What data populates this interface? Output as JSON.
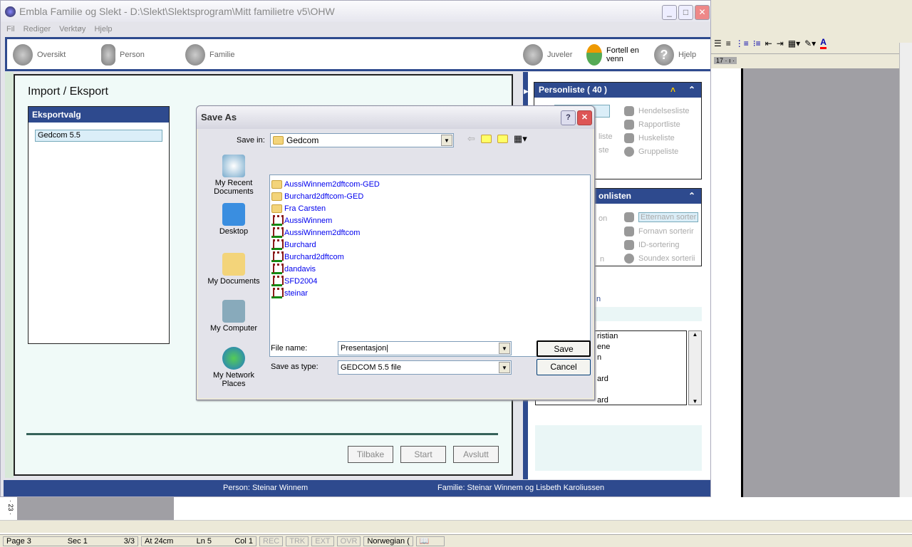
{
  "app": {
    "title": "Embla Familie og Slekt - D:\\Slekt\\Slektsprogram\\Mitt familietre v5\\OHW",
    "menu": [
      "Fil",
      "Rediger",
      "Verktøy",
      "Hjelp"
    ],
    "toolbar": {
      "left": [
        "Oversikt",
        "Person",
        "Familie"
      ],
      "juveler": "Juveler",
      "fortell": "Fortell en venn",
      "hjelp": "Hjelp"
    },
    "page_title": "Import / Eksport",
    "eksportvalg": {
      "header": "Eksportvalg",
      "items": [
        "Gedcom 5.5"
      ]
    },
    "buttons": {
      "back": "Tilbake",
      "start": "Start",
      "exit": "Avslutt"
    },
    "status": {
      "person": "Person: Steinar Winnem",
      "family": "Familie: Steinar Winnem og Lisbeth Karoliussen"
    }
  },
  "right_panel": {
    "personliste": {
      "header": "Personliste ( 40 )",
      "items": [
        "liste",
        "ste",
        "Hendelsesliste",
        "Rapportliste",
        "Huskeliste",
        "Gruppeliste"
      ]
    },
    "sort": {
      "header": "onlisten",
      "left_items": [
        "on",
        "n"
      ],
      "items": [
        "Etternavn sorter",
        "Fornavn sorterir",
        "ID-sortering",
        "Soundex sorterii"
      ]
    },
    "label_fragment": "n",
    "list_fragments": [
      "ristian",
      "ene",
      "n",
      "ard",
      "ard"
    ]
  },
  "dialog": {
    "title": "Save As",
    "save_in_label": "Save in:",
    "save_in": "Gedcom",
    "places": [
      "My Recent Documents",
      "Desktop",
      "My Documents",
      "My Computer",
      "My Network Places"
    ],
    "folders": [
      "AussiWinnem2dftcom-GED",
      "Burchard2dftcom-GED",
      "Fra Carsten"
    ],
    "files": [
      "AussiWinnem",
      "AussiWinnem2dftcom",
      "Burchard",
      "Burchard2dftcom",
      "dandavis",
      "SFD2004",
      "steinar"
    ],
    "file_name_label": "File name:",
    "file_name": "Presentasjon",
    "type_label": "Save as type:",
    "type": "GEDCOM 5.5 file",
    "save": "Save",
    "cancel": "Cancel"
  },
  "word": {
    "ruler": "17 · ı ·",
    "vruler": "· 23 ·",
    "status": {
      "page": "Page 3",
      "sec": "Sec 1",
      "pages": "3/3",
      "at": "At 24cm",
      "ln": "Ln 5",
      "col": "Col 1",
      "rec": "REC",
      "trk": "TRK",
      "ext": "EXT",
      "ovr": "OVR",
      "lang": "Norwegian ("
    }
  },
  "colors": {
    "accent": "#2e4a8e",
    "link": "#0000ee",
    "panel_bg": "#f0faf8"
  }
}
